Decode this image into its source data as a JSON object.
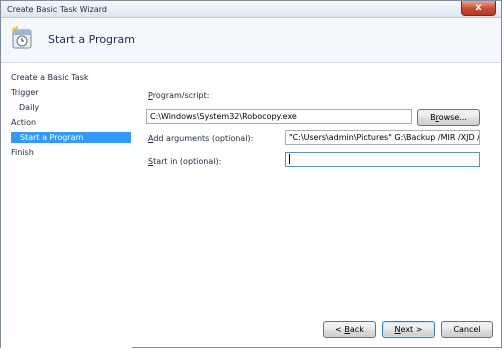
{
  "window": {
    "title": "Create Basic Task Wizard",
    "close_glyph": "x"
  },
  "header": {
    "title": "Start a Program",
    "icon": "task-scheduler-clock-icon"
  },
  "nav": {
    "items": [
      {
        "label": "Create a Basic Task"
      },
      {
        "label": "Trigger"
      },
      {
        "label": "Daily"
      },
      {
        "label": "Action"
      },
      {
        "label": "Start a Program"
      },
      {
        "label": "Finish"
      }
    ],
    "selected_color": "#3399ff"
  },
  "form": {
    "program_label_pre": "",
    "program_label_key": "P",
    "program_label_post": "rogram/script:",
    "program_value": "C:\\Windows\\System32\\Robocopy.exe",
    "browse_label_pre": "B",
    "browse_label_key": "r",
    "browse_label_post": "owse...",
    "args_label_key": "A",
    "args_label_post": "dd arguments (optional):",
    "args_value": "\"C:\\Users\\admin\\Pictures\" G:\\Backup /MIR /XJD /R:",
    "startin_label_key": "S",
    "startin_label_post": "tart in (optional):",
    "startin_value": ""
  },
  "buttons": {
    "back_pre": "< ",
    "back_key": "B",
    "back_post": "ack",
    "next_key": "N",
    "next_post": "ext >",
    "cancel": "Cancel"
  }
}
